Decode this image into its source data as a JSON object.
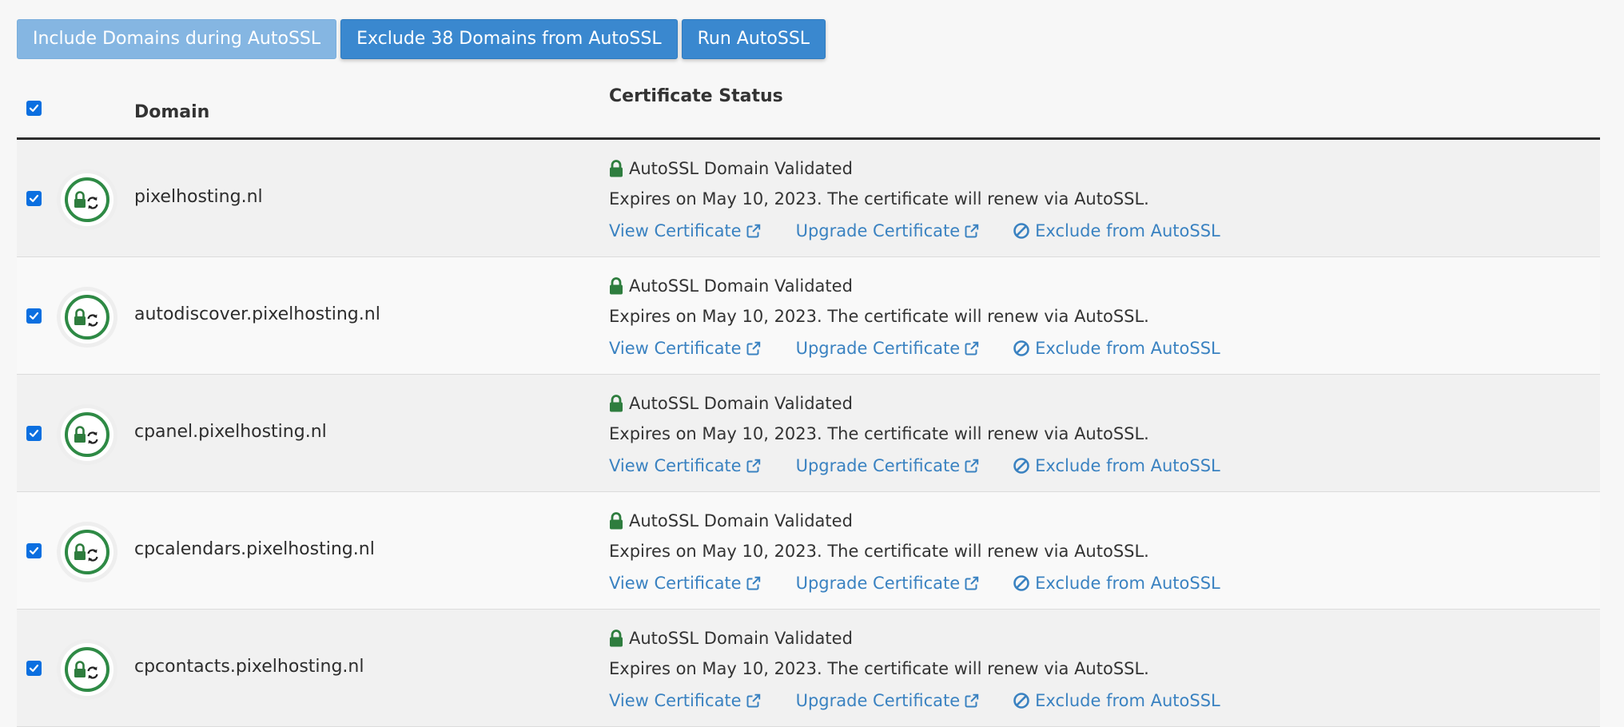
{
  "toolbar": {
    "include_label": "Include Domains during AutoSSL",
    "exclude_label": "Exclude 38 Domains from AutoSSL",
    "run_label": "Run AutoSSL"
  },
  "table": {
    "columns": {
      "domain": "Domain",
      "status": "Certificate Status"
    },
    "rows": [
      {
        "domain": "pixelhosting.nl",
        "status": "AutoSSL Domain Validated",
        "expires": "Expires on May 10, 2023. The certificate will renew via AutoSSL.",
        "view": "View Certificate",
        "upgrade": "Upgrade Certificate",
        "exclude": "Exclude from AutoSSL"
      },
      {
        "domain": "autodiscover.pixelhosting.nl",
        "status": "AutoSSL Domain Validated",
        "expires": "Expires on May 10, 2023. The certificate will renew via AutoSSL.",
        "view": "View Certificate",
        "upgrade": "Upgrade Certificate",
        "exclude": "Exclude from AutoSSL"
      },
      {
        "domain": "cpanel.pixelhosting.nl",
        "status": "AutoSSL Domain Validated",
        "expires": "Expires on May 10, 2023. The certificate will renew via AutoSSL.",
        "view": "View Certificate",
        "upgrade": "Upgrade Certificate",
        "exclude": "Exclude from AutoSSL"
      },
      {
        "domain": "cpcalendars.pixelhosting.nl",
        "status": "AutoSSL Domain Validated",
        "expires": "Expires on May 10, 2023. The certificate will renew via AutoSSL.",
        "view": "View Certificate",
        "upgrade": "Upgrade Certificate",
        "exclude": "Exclude from AutoSSL"
      },
      {
        "domain": "cpcontacts.pixelhosting.nl",
        "status": "AutoSSL Domain Validated",
        "expires": "Expires on May 10, 2023. The certificate will renew via AutoSSL.",
        "view": "View Certificate",
        "upgrade": "Upgrade Certificate",
        "exclude": "Exclude from AutoSSL"
      }
    ]
  },
  "icons": {
    "ssl_status": "lock-sync-icon",
    "validated": "lock-icon",
    "external": "external-link-icon",
    "exclude": "ban-icon"
  },
  "colors": {
    "primary_button": "#3a88cf",
    "disabled_button": "#85b6e2",
    "link": "#3a82c1",
    "validated_green": "#2e7d3e",
    "checkbox": "#0b6fe0"
  }
}
